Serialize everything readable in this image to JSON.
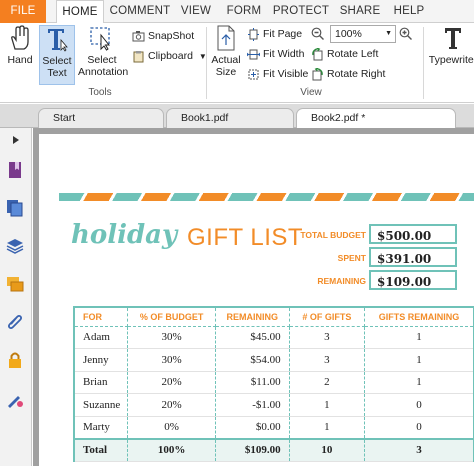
{
  "menu": {
    "tabs": [
      "FILE",
      "HOME",
      "COMMENT",
      "VIEW",
      "FORM",
      "PROTECT",
      "SHARE",
      "HELP"
    ]
  },
  "ribbon": {
    "hand": "Hand",
    "select_text": [
      "Select",
      "Text"
    ],
    "select_annotation": [
      "Select",
      "Annotation"
    ],
    "snapshot": "SnapShot",
    "clipboard": "Clipboard",
    "actual_size": [
      "Actual",
      "Size"
    ],
    "fit_page": "Fit Page",
    "fit_width": "Fit Width",
    "fit_visible": "Fit Visible",
    "zoom_value": "100%",
    "rotate_left": "Rotate Left",
    "rotate_right": "Rotate Right",
    "typewriter": "Typewriter",
    "group_tools": "Tools",
    "group_view": "View"
  },
  "doctabs": [
    "Start",
    "Book1.pdf",
    "Book2.pdf *"
  ],
  "document": {
    "title_script": "holiday",
    "title_main": "GIFT LIST",
    "budget": [
      {
        "label": "TOTAL BUDGET",
        "value": "$500.00"
      },
      {
        "label": "SPENT",
        "value": "$391.00"
      },
      {
        "label": "REMAINING",
        "value": "$109.00"
      }
    ],
    "table": {
      "headers": [
        "FOR",
        "% OF BUDGET",
        "REMAINING",
        "# OF GIFTS",
        "GIFTS REMAINING"
      ],
      "rows": [
        [
          "Adam",
          "30%",
          "$45.00",
          "3",
          "1"
        ],
        [
          "Jenny",
          "30%",
          "$54.00",
          "3",
          "1"
        ],
        [
          "Brian",
          "20%",
          "$11.00",
          "2",
          "1"
        ],
        [
          "Suzanne",
          "20%",
          "-$1.00",
          "1",
          "0"
        ],
        [
          "Marty",
          "0%",
          "$0.00",
          "1",
          "0"
        ]
      ],
      "total": [
        "Total",
        "100%",
        "$109.00",
        "10",
        "3"
      ]
    }
  },
  "colors": {
    "accent_orange": "#f28c28",
    "accent_teal": "#6fc2b8",
    "file_tab": "#f47f20"
  }
}
